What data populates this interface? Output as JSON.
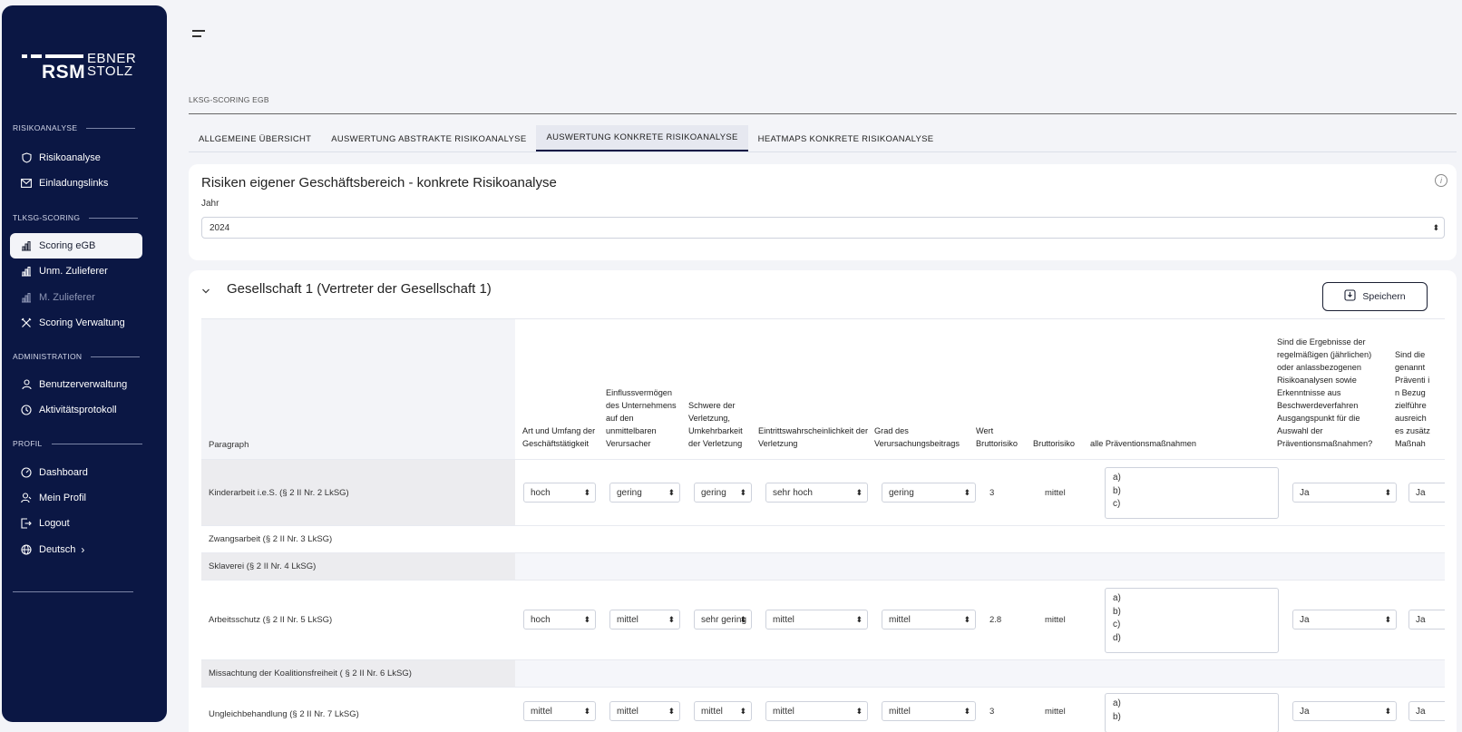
{
  "sidebar": {
    "logo": {
      "rsm": "RSM",
      "ebner": "EBNER",
      "stolz": "STOLZ"
    },
    "sections": [
      {
        "title": "RISIKOANALYSE",
        "items": [
          {
            "label": "Risikoanalyse",
            "icon": "shield-icon"
          },
          {
            "label": "Einladungslinks",
            "icon": "mail-icon"
          }
        ]
      },
      {
        "title": "TLKSG-SCORING",
        "items": [
          {
            "label": "Scoring eGB",
            "icon": "chart-icon"
          },
          {
            "label": "Unm. Zulieferer",
            "icon": "chart-icon"
          },
          {
            "label": "M. Zulieferer",
            "icon": "chart-icon"
          },
          {
            "label": "Scoring Verwaltung",
            "icon": "tools-icon"
          }
        ]
      },
      {
        "title": "ADMINISTRATION",
        "items": [
          {
            "label": "Benutzerverwaltung",
            "icon": "user-icon"
          },
          {
            "label": "Aktivitätsprotokoll",
            "icon": "clock-icon"
          }
        ]
      },
      {
        "title": "PROFIL",
        "items": [
          {
            "label": "Dashboard",
            "icon": "dashboard-icon"
          },
          {
            "label": "Mein Profil",
            "icon": "profile-icon"
          },
          {
            "label": "Logout",
            "icon": "logout-icon"
          },
          {
            "label": "Deutsch",
            "icon": "globe-icon"
          }
        ]
      }
    ]
  },
  "breadcrumb": "LKSG-SCORING EGB",
  "tabs": [
    {
      "label": "ALLGEMEINE ÜBERSICHT"
    },
    {
      "label": "AUSWERTUNG ABSTRAKTE RISIKOANALYSE"
    },
    {
      "label": "AUSWERTUNG KONKRETE RISIKOANALYSE"
    },
    {
      "label": "HEATMAPS KONKRETE RISIKOANALYSE"
    }
  ],
  "card": {
    "title": "Risiken eigener Geschäftsbereich - konkrete Risikoanalyse",
    "year_label": "Jahr",
    "year_value": "2024",
    "info": "i"
  },
  "group": {
    "title": "Gesellschaft 1 (Vertreter der Gesellschaft 1)",
    "save_label": "Speichern"
  },
  "table": {
    "headers": {
      "paragraph": "Paragraph",
      "art": "Art und Umfang der Geschäftstätigkeit",
      "einfluss": "Einflussvermögen des Unternehmens auf den unmittelbaren Verursacher",
      "schwere": "Schwere der Verletzung, Umkehrbarkeit der Verletzung",
      "eintritt": "Eintrittswahrscheinlichkeit der Verletzung",
      "grad": "Grad des Verursachungsbeitrags",
      "wert": "Wert Bruttorisiko",
      "brutto": "Bruttorisiko",
      "praev": "alle Präventionsmaßnahmen",
      "ergebnisse": "Sind die Ergebnisse der regelmäßigen (jährlichen) oder anlassbezogenen Risikoanalysen sowie Erkenntnisse aus Beschwerdeverfahren Ausgangspunkt für die Auswahl der Präventionsmaßnahmen?",
      "sind": "Sind die genannt Präventi in Bezug zielführe ausreich es zusätz Maßnah"
    },
    "rows": [
      {
        "label": "Kinderarbeit i.e.S. (§ 2 II Nr. 2 LkSG)",
        "art": "hoch",
        "einfluss": "gering",
        "schwere": "gering",
        "eintritt": "sehr hoch",
        "grad": "gering",
        "wert": "3",
        "brutto": "mittel",
        "praev": [
          "a)",
          "b)",
          "c)"
        ],
        "ergebnisse": "Ja",
        "sind": "Ja"
      },
      {
        "label": "Zwangsarbeit (§ 2 II Nr. 3 LkSG)"
      },
      {
        "label": "Sklaverei (§ 2 II Nr. 4 LkSG)"
      },
      {
        "label": "Arbeitsschutz (§ 2 II Nr. 5 LkSG)",
        "art": "hoch",
        "einfluss": "mittel",
        "schwere": "sehr gering",
        "eintritt": "mittel",
        "grad": "mittel",
        "wert": "2.8",
        "brutto": "mittel",
        "praev": [
          "a)",
          "b)",
          "c)",
          "d)"
        ],
        "ergebnisse": "Ja",
        "sind": "Ja"
      },
      {
        "label": "Missachtung der Koalitionsfreiheit ( § 2 II Nr. 6 LkSG)"
      },
      {
        "label": "Ungleichbehandlung (§ 2 II Nr. 7 LkSG)",
        "art": "mittel",
        "einfluss": "mittel",
        "schwere": "mittel",
        "eintritt": "mittel",
        "grad": "mittel",
        "wert": "3",
        "brutto": "mittel",
        "praev": [
          "a)",
          "b)"
        ],
        "ergebnisse": "Ja",
        "sind": "Ja"
      }
    ]
  }
}
